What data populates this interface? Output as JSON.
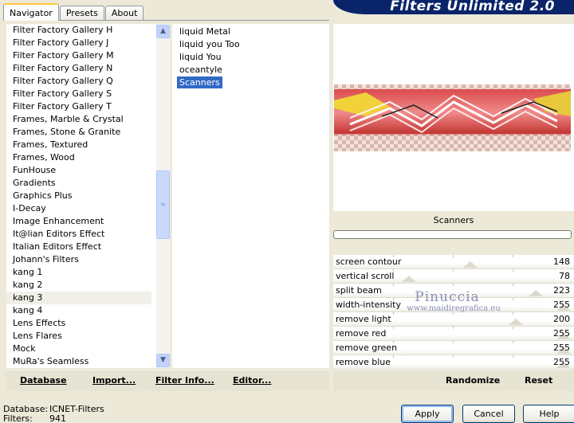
{
  "tabs": [
    {
      "label": "Navigator",
      "active": true
    },
    {
      "label": "Presets",
      "active": false
    },
    {
      "label": "About",
      "active": false
    }
  ],
  "banner_title": "Filters Unlimited 2.0",
  "categories": [
    "Filter Factory Gallery H",
    "Filter Factory Gallery J",
    "Filter Factory Gallery M",
    "Filter Factory Gallery N",
    "Filter Factory Gallery Q",
    "Filter Factory Gallery S",
    "Filter Factory Gallery T",
    "Frames, Marble & Crystal",
    "Frames, Stone & Granite",
    "Frames, Textured",
    "Frames, Wood",
    "FunHouse",
    "Gradients",
    "Graphics Plus",
    "I-Decay",
    "Image Enhancement",
    "It@lian Editors Effect",
    "Italian Editors Effect",
    "Johann's Filters",
    "kang 1",
    "kang 2",
    "kang 3",
    "kang 4",
    "Lens Effects",
    "Lens Flares",
    "Mock",
    "MuRa's Seamless"
  ],
  "current_category": "kang 3",
  "filters": [
    "liquid Metal",
    "liquid you Too",
    "liquid You",
    "oceantyle",
    "Scanners"
  ],
  "selected_filter": "Scanners",
  "filter_name": "Scanners",
  "params": [
    {
      "name": "screen contour",
      "value": 148
    },
    {
      "name": "vertical scroll",
      "value": 78
    },
    {
      "name": "split beam",
      "value": 223
    },
    {
      "name": "width-intensity",
      "value": 255
    },
    {
      "name": "remove light",
      "value": 200
    },
    {
      "name": "remove red",
      "value": 255
    },
    {
      "name": "remove green",
      "value": 255
    },
    {
      "name": "remove blue",
      "value": 255
    }
  ],
  "param_max": 255,
  "watermark": {
    "title": "Pinuccia",
    "subtitle": "www.maidiregrafica.eu"
  },
  "left_buttons": {
    "database": "Database",
    "import": "Import...",
    "filter_info": "Filter Info...",
    "editor": "Editor..."
  },
  "right_buttons": {
    "randomize": "Randomize",
    "reset": "Reset"
  },
  "status": {
    "database_label": "Database:",
    "database_value": "ICNET-Filters",
    "filters_label": "Filters:",
    "filters_value": "941"
  },
  "dialog_buttons": {
    "apply": "Apply",
    "cancel": "Cancel",
    "help": "Help"
  },
  "colors": {
    "selection": "#316ac5",
    "banner": "#0a246a",
    "background": "#ece9d8",
    "watermark": "#8a90b8"
  },
  "icons": {
    "scroll_up": "scroll-up-arrow-icon",
    "scroll_down": "scroll-down-arrow-icon"
  }
}
